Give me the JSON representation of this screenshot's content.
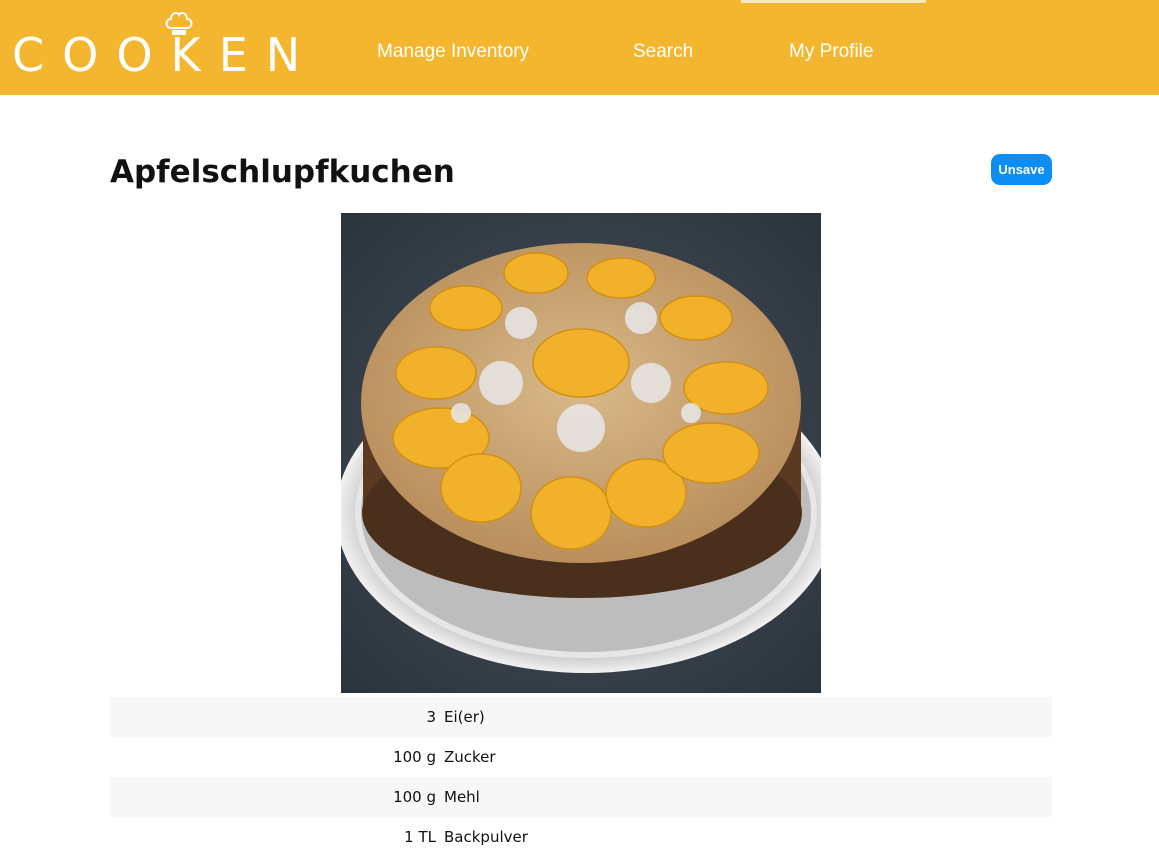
{
  "header": {
    "logo_text": "COOKEN",
    "nav": [
      {
        "label": "Manage Inventory"
      },
      {
        "label": "Search"
      },
      {
        "label": "My Profile"
      }
    ],
    "background_color": "#f4b62f"
  },
  "recipe": {
    "title": "Apfelschlupfkuchen",
    "unsave_label": "Unsave",
    "image_icon": "cake-photo",
    "ingredients": [
      {
        "amount": "3",
        "name": "Ei(er)"
      },
      {
        "amount": "100 g",
        "name": "Zucker"
      },
      {
        "amount": "100 g",
        "name": "Mehl"
      },
      {
        "amount": "1 TL",
        "name": "Backpulver"
      }
    ]
  },
  "colors": {
    "accent": "#f4b62f",
    "button": "#0d8ef5",
    "row_stripe": "#f7f7f7"
  }
}
